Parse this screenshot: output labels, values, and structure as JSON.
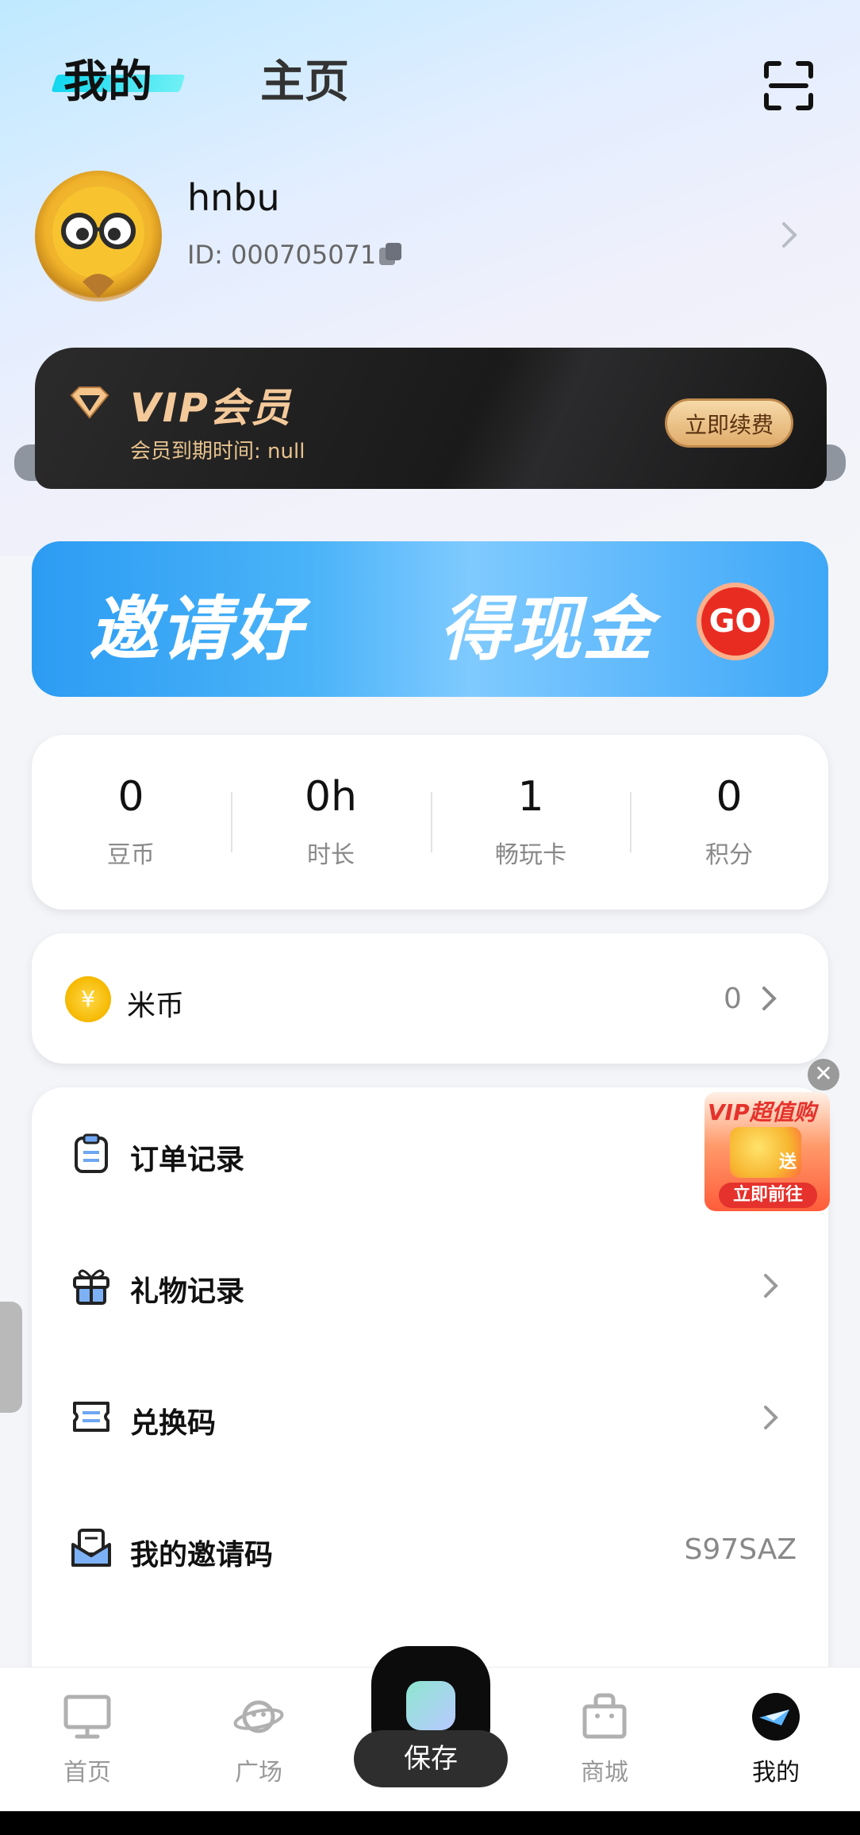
{
  "header": {
    "tab_mine": "我的",
    "tab_home": "主页",
    "scan_icon": "scan-icon"
  },
  "profile": {
    "username": "hnbu",
    "id_text": "ID: 000705071",
    "avatar_icon": "cartoon-avatar-with-glasses",
    "copy_icon": "copy-icon"
  },
  "vip": {
    "title": "VIP会员",
    "expire_text": "会员到期时间: null",
    "renew_label": "立即续费",
    "accent": "#f4c99a"
  },
  "invite_banner": {
    "text_left": "邀请好",
    "text_right": "得现金",
    "go_label": "GO"
  },
  "stats": [
    {
      "value": "0",
      "label": "豆币"
    },
    {
      "value": "0h",
      "label": "时长"
    },
    {
      "value": "1",
      "label": "畅玩卡"
    },
    {
      "value": "0",
      "label": "积分"
    }
  ],
  "coin": {
    "label": "米币",
    "value": "0",
    "icon_glyph": "¥"
  },
  "menu": [
    {
      "label": "订单记录",
      "icon": "clipboard-icon",
      "value": "",
      "arrow": false
    },
    {
      "label": "礼物记录",
      "icon": "gift-icon",
      "value": "",
      "arrow": true
    },
    {
      "label": "兑换码",
      "icon": "ticket-icon",
      "value": "",
      "arrow": true
    },
    {
      "label": "我的邀请码",
      "icon": "envelope-icon",
      "value": "S97SAZ",
      "arrow": false
    }
  ],
  "promo": {
    "title": "VIP超值购",
    "gift_text": "送",
    "button_label": "立即前往",
    "close_glyph": "✕"
  },
  "bottom_nav": {
    "items": [
      {
        "label": "首页",
        "icon": "monitor-icon",
        "active": false
      },
      {
        "label": "广场",
        "icon": "planet-icon",
        "active": false
      },
      {
        "label": "商城",
        "icon": "shopping-bag-icon",
        "active": false
      },
      {
        "label": "我的",
        "icon": "profile-logo-icon",
        "active": true
      }
    ],
    "center_label": "保存"
  }
}
